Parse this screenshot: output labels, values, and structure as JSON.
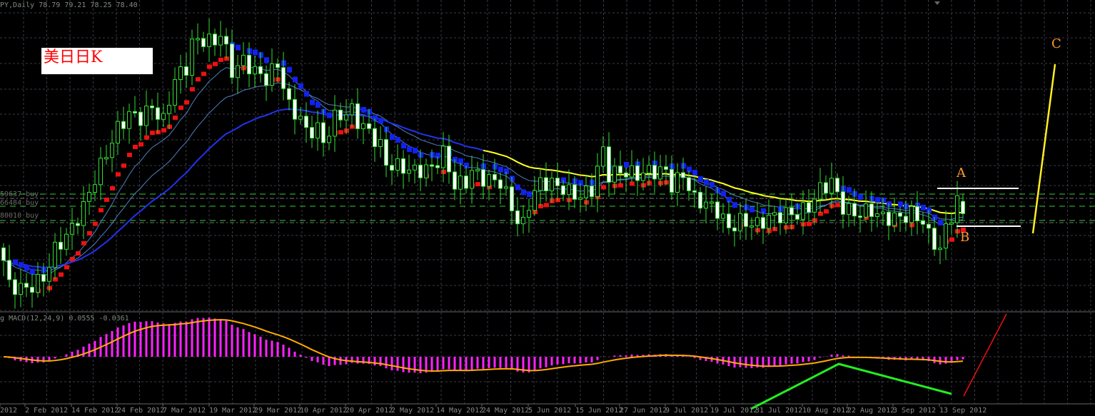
{
  "header": {
    "symbol": "PY,Daily",
    "ohlc": "78.79 79.21 78.25 78.40"
  },
  "macd_header": {
    "prefix": "g",
    "label": "MACD(12,24,9)",
    "values": "0.0555 -0.0361"
  },
  "note_label": "美日日K",
  "levels": [
    {
      "text": "59637 buy"
    },
    {
      "text": "66484 buy"
    },
    {
      "text": "80010 buy"
    }
  ],
  "wave_labels": {
    "a": "A",
    "b": "B",
    "c": "C"
  },
  "x_ticks": [
    "2012",
    "2 Feb 2012",
    "14 Feb 2012",
    "24 Feb 2012",
    "7 Mar 2012",
    "19 Mar 2012",
    "29 Mar 2012",
    "10 Apr 2012",
    "20 Apr 2012",
    "2 May 2012",
    "14 May 2012",
    "24 May 2012",
    "5 Jun 2012",
    "15 Jun 2012",
    "27 Jun 2012",
    "9 Jul 2012",
    "19 Jul 2012",
    "31 Jul 2012",
    "10 Aug 2012",
    "22 Aug 2012",
    "3 Sep 2012",
    "13 Sep 2012"
  ],
  "colors": {
    "background": "#000000",
    "grid": "#3a3a4a",
    "candle": "#33dd33",
    "ma_long_up": "#2233ee",
    "ma_long_down": "#ffff22",
    "bands": "#4f7fbf",
    "trend_up": "#ee1111",
    "trend_down": "#1122ee",
    "macd_hist": "#ff22ff",
    "macd_signal": "#ffaa00",
    "wave_up": "#22ee22",
    "wave_red": "#ee1111",
    "wave_yellow": "#ffee22"
  },
  "chart_data": {
    "type": "candlestick",
    "title": "USDJPY Daily",
    "price_range": [
      75.6,
      84.9
    ],
    "close_anchors": [
      [
        0,
        76.91
      ],
      [
        1,
        76.11
      ],
      [
        4,
        76.0
      ],
      [
        7,
        76.34
      ],
      [
        9,
        77.25
      ],
      [
        12,
        77.93
      ],
      [
        14,
        78.61
      ],
      [
        16,
        79.52
      ],
      [
        18,
        80.32
      ],
      [
        20,
        81.11
      ],
      [
        22,
        81.57
      ],
      [
        24,
        81.45
      ],
      [
        26,
        81.8
      ],
      [
        28,
        81.34
      ],
      [
        30,
        82.7
      ],
      [
        32,
        83.05
      ],
      [
        33,
        83.84
      ],
      [
        35,
        83.95
      ],
      [
        37,
        83.84
      ],
      [
        38,
        84.18
      ],
      [
        40,
        82.93
      ],
      [
        42,
        83.27
      ],
      [
        44,
        82.93
      ],
      [
        46,
        82.7
      ],
      [
        48,
        83.16
      ],
      [
        50,
        81.8
      ],
      [
        52,
        81.45
      ],
      [
        53,
        81.0
      ],
      [
        55,
        81.11
      ],
      [
        56,
        80.66
      ],
      [
        58,
        81.45
      ],
      [
        61,
        81.68
      ],
      [
        62,
        81.34
      ],
      [
        64,
        81.0
      ],
      [
        66,
        80.55
      ],
      [
        67,
        79.98
      ],
      [
        70,
        79.86
      ],
      [
        72,
        79.75
      ],
      [
        75,
        79.86
      ],
      [
        77,
        80.32
      ],
      [
        79,
        79.3
      ],
      [
        81,
        79.41
      ],
      [
        82,
        79.75
      ],
      [
        84,
        79.52
      ],
      [
        87,
        79.41
      ],
      [
        89,
        78.61
      ],
      [
        90,
        78.16
      ],
      [
        91,
        78.05
      ],
      [
        92,
        78.73
      ],
      [
        94,
        79.41
      ],
      [
        97,
        79.3
      ],
      [
        99,
        79.07
      ],
      [
        101,
        78.95
      ],
      [
        103,
        79.18
      ],
      [
        105,
        80.43
      ],
      [
        106,
        79.64
      ],
      [
        108,
        79.75
      ],
      [
        111,
        79.64
      ],
      [
        113,
        79.75
      ],
      [
        116,
        79.75
      ],
      [
        117,
        79.3
      ],
      [
        119,
        79.64
      ],
      [
        121,
        78.84
      ],
      [
        123,
        78.73
      ],
      [
        125,
        78.5
      ],
      [
        127,
        77.93
      ],
      [
        129,
        78.16
      ],
      [
        132,
        78.05
      ],
      [
        134,
        78.27
      ],
      [
        137,
        78.39
      ],
      [
        139,
        78.39
      ],
      [
        141,
        78.61
      ],
      [
        143,
        79.18
      ],
      [
        145,
        79.41
      ],
      [
        147,
        78.61
      ],
      [
        149,
        78.39
      ],
      [
        152,
        78.5
      ],
      [
        154,
        78.27
      ],
      [
        157,
        78.27
      ],
      [
        159,
        78.39
      ],
      [
        161,
        78.16
      ],
      [
        162,
        77.7
      ],
      [
        164,
        77.25
      ],
      [
        165,
        77.93
      ],
      [
        167,
        78.79
      ],
      [
        168,
        78.4
      ]
    ],
    "last_candle": {
      "open": 78.79,
      "high": 79.21,
      "low": 78.25,
      "close": 78.4
    },
    "indicators": [
      "MA long (blue rising / yellow falling)",
      "MA bands",
      "trend dots",
      "MACD(12,24,9)"
    ],
    "macd": {
      "params": [
        12,
        24,
        9
      ],
      "main": 0.0555,
      "signal": -0.0361
    }
  }
}
